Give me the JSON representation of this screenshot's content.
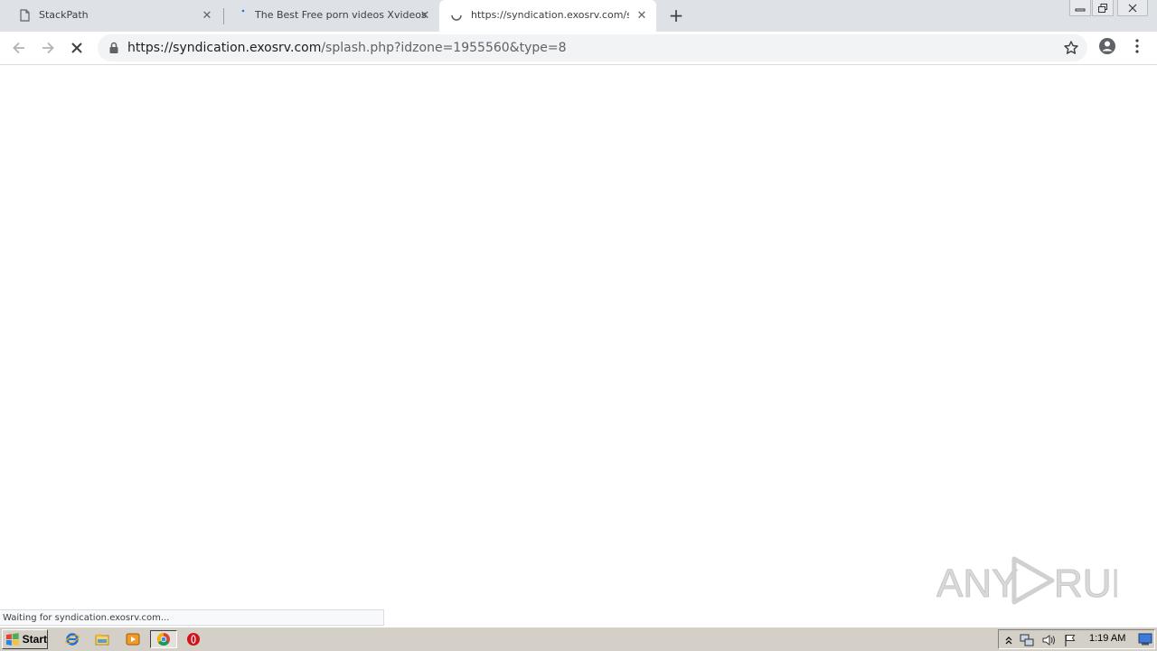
{
  "browser": {
    "tabs": [
      {
        "title": "StackPath",
        "favicon": "page-icon",
        "active": false
      },
      {
        "title": "The Best Free porn videos Xvideos",
        "favicon": "loading-dot-icon",
        "active": false
      },
      {
        "title": "https://syndication.exosrv.com/spla",
        "favicon": "loading-spinner-icon",
        "active": true
      }
    ],
    "new_tab_label": "+",
    "address": {
      "host": "https://syndication.exosrv.com",
      "path": "/splash.php?idzone=1955560&type=8"
    },
    "status_text": "Waiting for syndication.exosrv.com..."
  },
  "watermark": {
    "text": "ANY RUN"
  },
  "taskbar": {
    "start_label": "Start",
    "quick_launch": [
      "internet-explorer-icon",
      "file-explorer-icon",
      "media-player-icon",
      "chrome-icon",
      "opera-icon"
    ],
    "tray_icons": [
      "show-hidden-icons-arrow",
      "network-icon",
      "volume-icon",
      "action-center-flag-icon"
    ],
    "clock": "1:19 AM"
  },
  "colors": {
    "tabstrip": "#dee1e6",
    "omnibox": "#f1f3f4",
    "taskbar": "#d4d0c8"
  }
}
